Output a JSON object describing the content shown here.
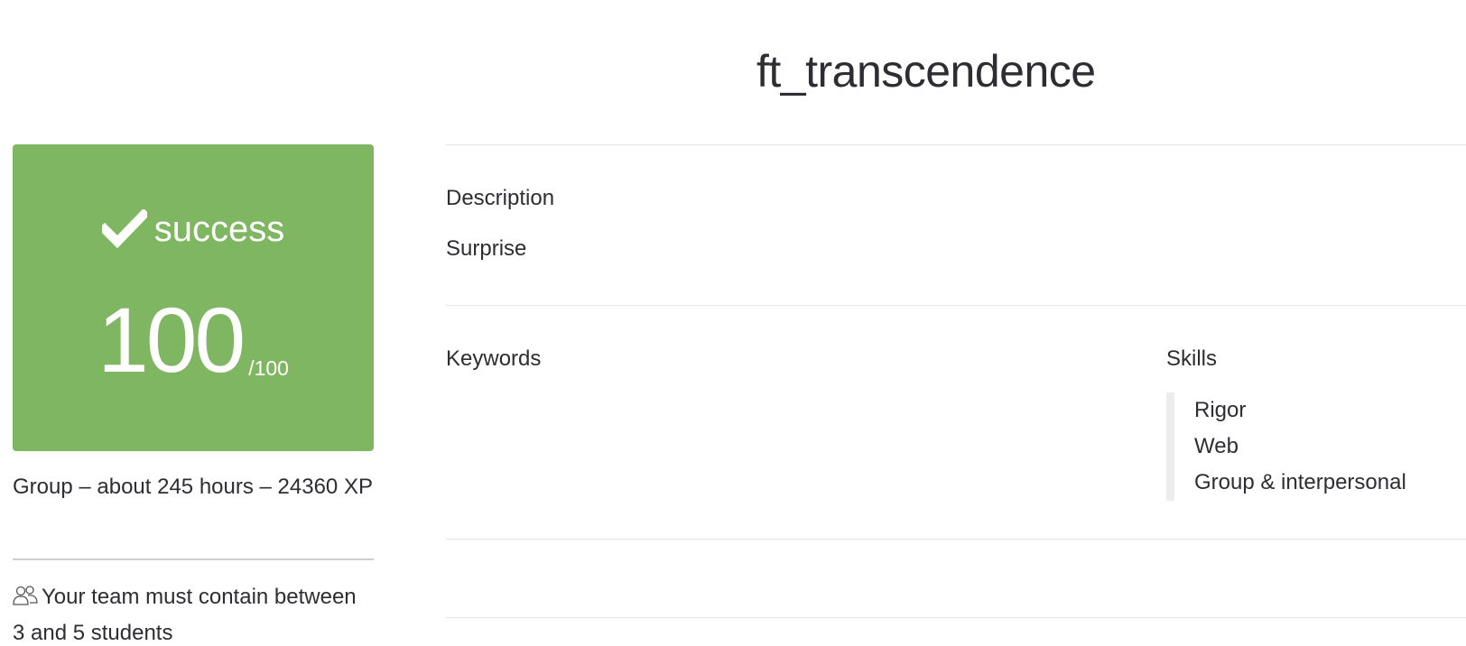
{
  "project": {
    "title": "ft_transcendence"
  },
  "result": {
    "status": "success",
    "score": "100",
    "max": "/100",
    "color": "#7fb661"
  },
  "meta": {
    "info": "Group – about 245 hours – 24360 XP",
    "team_icon": "team-icon",
    "team_rule": "Your team must contain between 3 and 5 students"
  },
  "description": {
    "label": "Description",
    "text": "Surprise"
  },
  "keywords": {
    "label": "Keywords"
  },
  "skills": {
    "label": "Skills",
    "items": [
      "Rigor",
      "Web",
      "Group & interpersonal"
    ]
  }
}
